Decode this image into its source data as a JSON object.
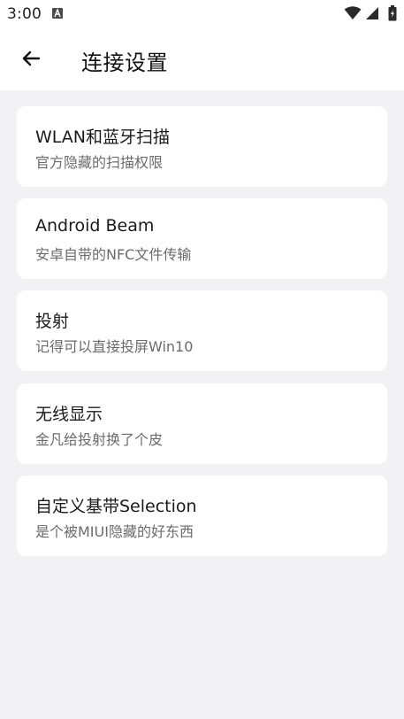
{
  "status_bar": {
    "time": "3:00"
  },
  "app_bar": {
    "title": "连接设置"
  },
  "items": [
    {
      "title": "WLAN和蓝牙扫描",
      "subtitle": "官方隐藏的扫描权限"
    },
    {
      "title": "Android Beam",
      "subtitle": "安卓自带的NFC文件传输"
    },
    {
      "title": "投射",
      "subtitle": "记得可以直接投屏Win10"
    },
    {
      "title": "无线显示",
      "subtitle": "金凡给投射换了个皮"
    },
    {
      "title": "自定义基带Selection",
      "subtitle": "是个被MIUI隐藏的好东西"
    }
  ],
  "icons": {
    "back": "arrow-left-icon",
    "notification": "a-letter-icon",
    "wifi": "wifi-icon",
    "signal": "signal-icon",
    "battery": "battery-icon"
  },
  "colors": {
    "background": "#f2f2f4",
    "card": "#ffffff",
    "title_text": "#1a1a1a",
    "subtitle_text": "#6b6b6b"
  }
}
